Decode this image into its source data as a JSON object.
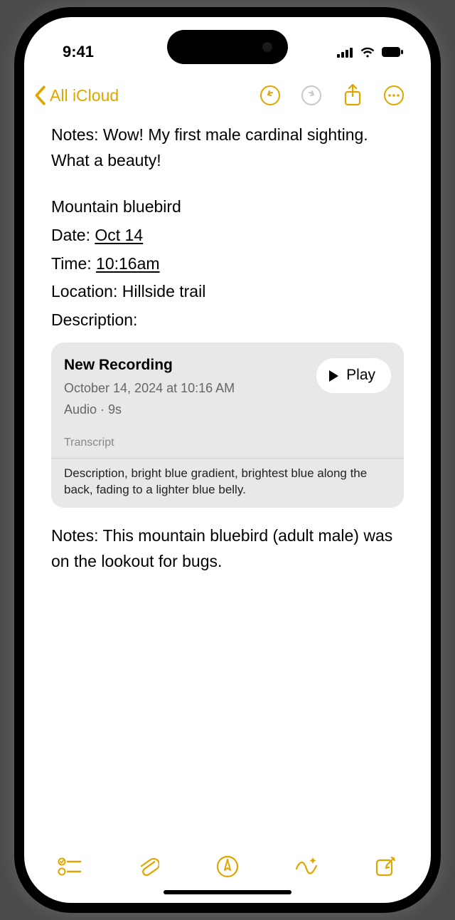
{
  "status": {
    "time": "9:41"
  },
  "nav": {
    "back_label": "All iCloud"
  },
  "content": {
    "line1": "Notes: Wow! My first male cardinal sighting. What a beauty!",
    "bird": "Mountain bluebird",
    "date_label": "Date: ",
    "date_value": "Oct 14",
    "time_label": "Time: ",
    "time_value": "10:16am",
    "location": "Location: Hillside trail",
    "description_label": "Description:",
    "notes2": "Notes: This mountain bluebird (adult male) was on the lookout for bugs."
  },
  "recording": {
    "title": "New Recording",
    "subtitle": "October 14, 2024 at 10:16 AM",
    "meta": "Audio · 9s",
    "play_label": "Play",
    "transcript_label": "Transcript",
    "transcript_text": "Description, bright blue gradient, brightest blue along the back, fading to a lighter blue belly."
  },
  "accent_color": "#e1a500"
}
